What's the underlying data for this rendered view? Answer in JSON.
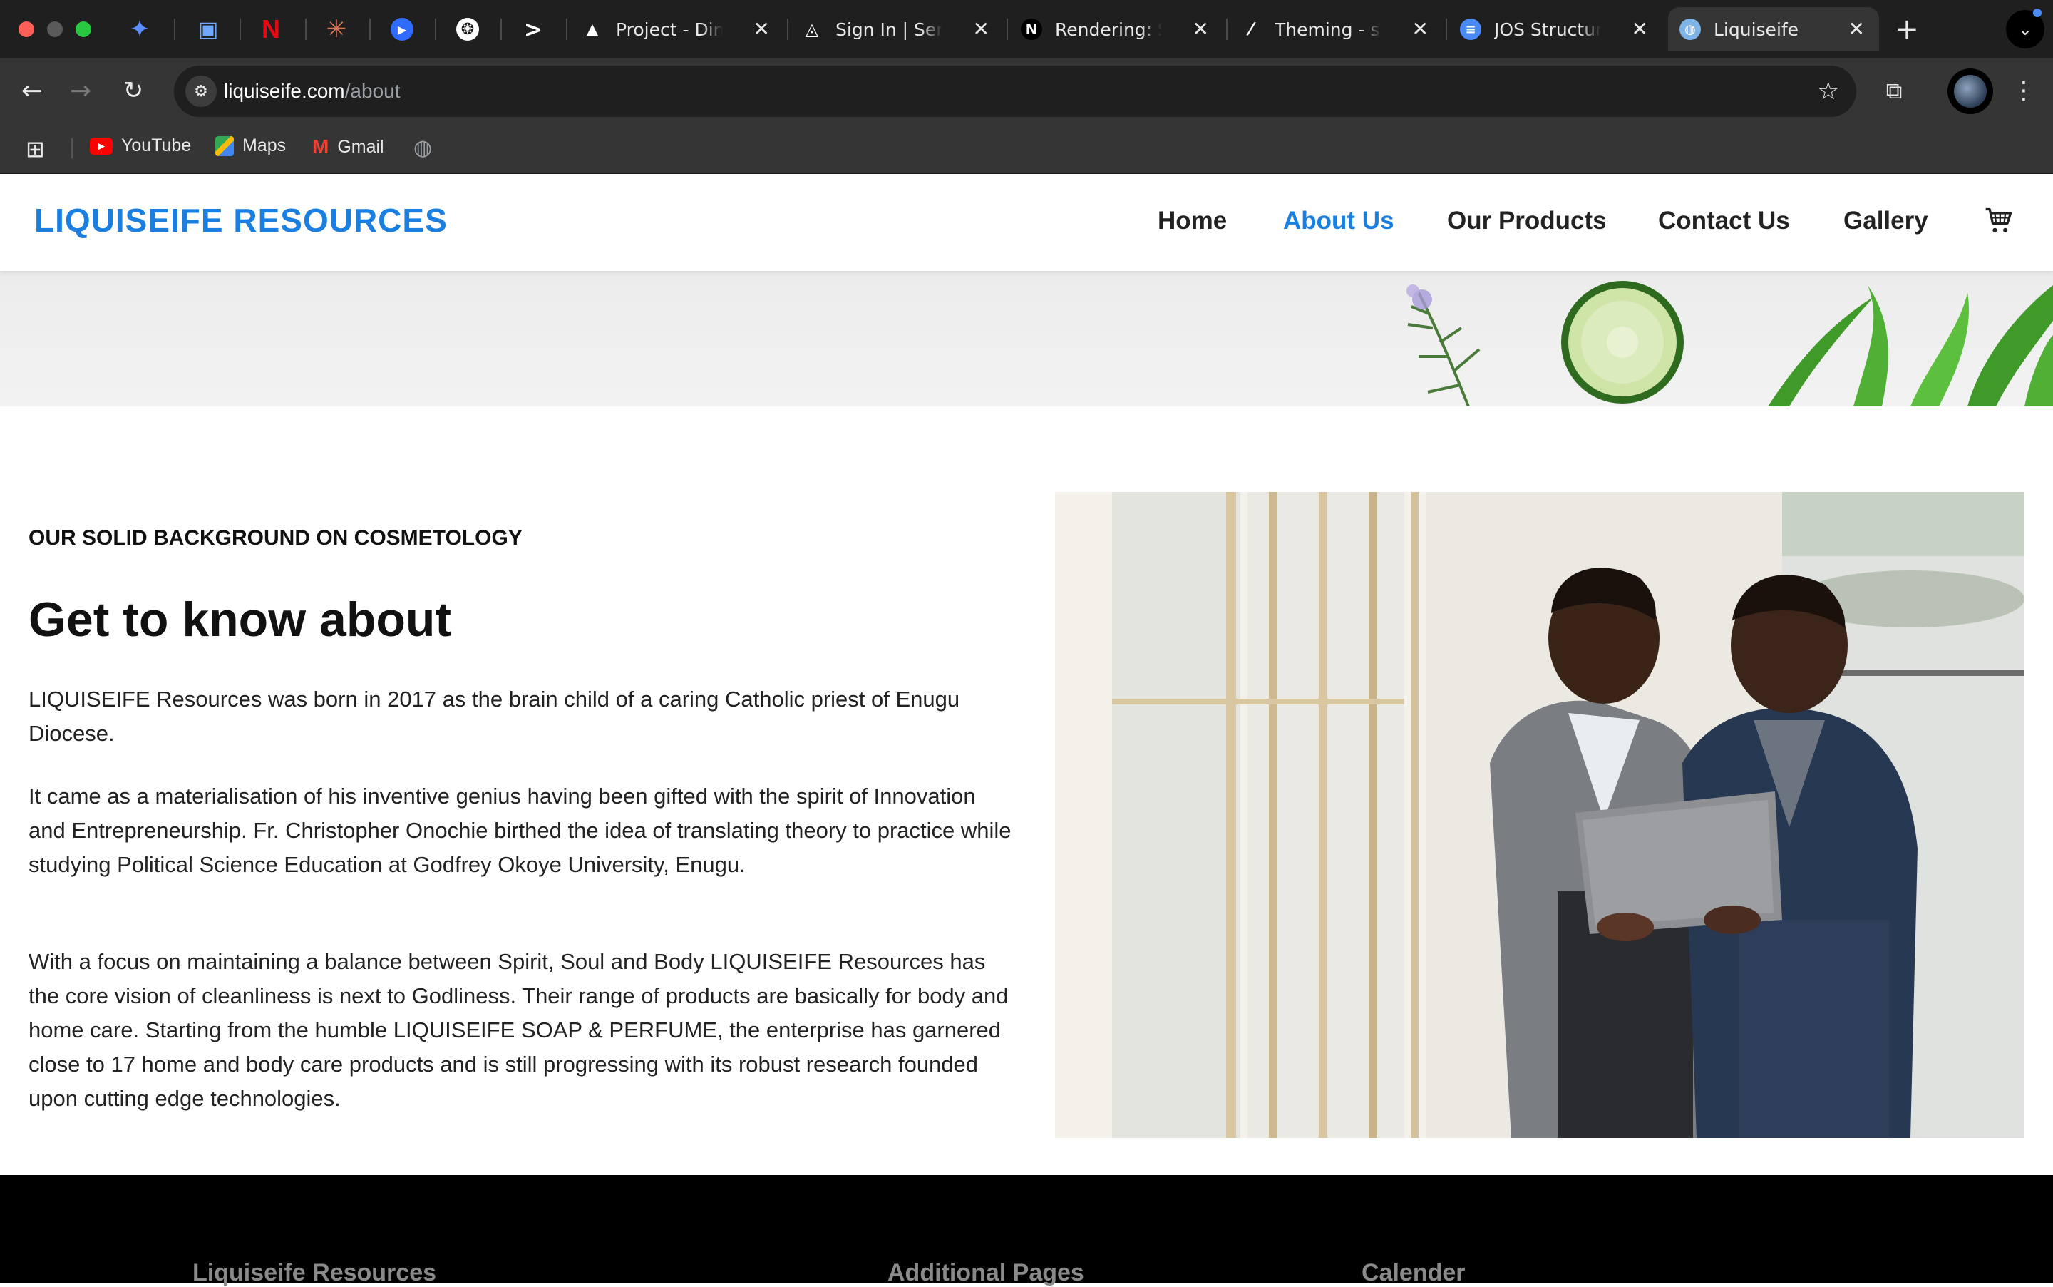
{
  "browser": {
    "tabs": [
      {
        "title": "Project - DineS"
      },
      {
        "title": "Sign In | Sentry"
      },
      {
        "title": "Rendering: Ser"
      },
      {
        "title": "Theming - sha"
      },
      {
        "title": "JOS Structure"
      },
      {
        "title": "Liquiseife"
      }
    ],
    "url_host": "liquiseife.com",
    "url_path": "/about",
    "bookmarks": [
      {
        "label": "YouTube"
      },
      {
        "label": "Maps"
      },
      {
        "label": "Gmail"
      }
    ]
  },
  "site": {
    "logo": "LIQUISEIFE RESOURCES",
    "nav": [
      {
        "label": "Home"
      },
      {
        "label": "About Us"
      },
      {
        "label": "Our Products"
      },
      {
        "label": "Contact Us"
      },
      {
        "label": "Gallery"
      }
    ],
    "accent_color": "#1a7fe0"
  },
  "about": {
    "eyebrow": "OUR SOLID BACKGROUND ON COSMETOLOGY",
    "heading": "Get to know about",
    "paragraphs": [
      "LIQUISEIFE Resources was born in 2017 as the brain child of a caring Catholic priest of Enugu Diocese.",
      "It came as a materialisation of his inventive genius having been gifted with the spirit of Innovation and Entrepreneurship. Fr. Christopher Onochie birthed the idea of translating theory to practice while studying Political Science Education at Godfrey Okoye University, Enugu.",
      "With a focus on maintaining a balance between Spirit, Soul and Body LIQUISEIFE Resources has the core vision of cleanliness is next to Godliness. Their range of products are basically for body and home care. Starting from the humble LIQUISEIFE SOAP & PERFUME, the enterprise has garnered close to 17 home and body care products and is still progressing with its robust research founded upon cutting edge technologies."
    ]
  },
  "footer": {
    "columns": [
      {
        "title": "Liquiseife Resources"
      },
      {
        "title": "Additional Pages"
      },
      {
        "title": "Calender"
      }
    ]
  }
}
